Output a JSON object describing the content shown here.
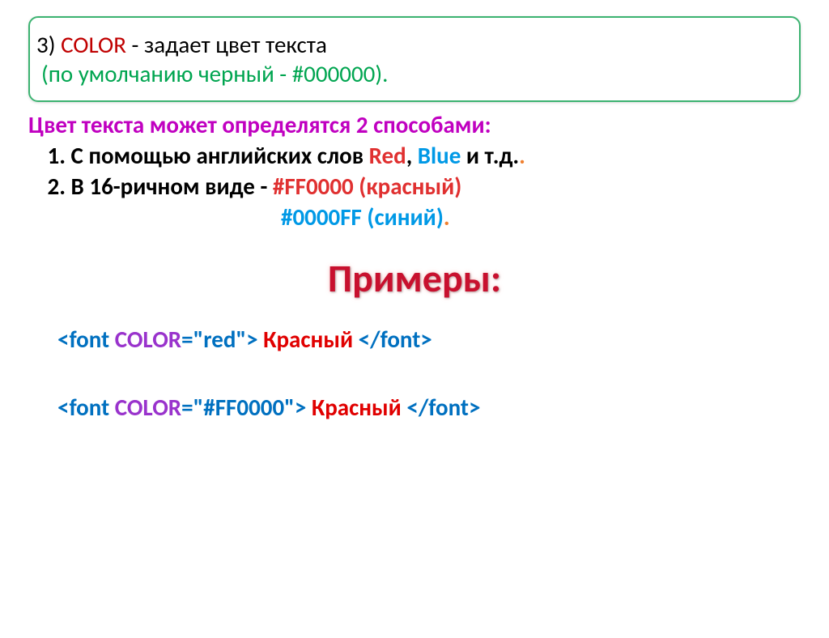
{
  "box": {
    "prefix": "3) ",
    "keyword": "COLOR",
    "suffix": " - задает цвет текста",
    "line2": "(по умолчанию черный - #000000)."
  },
  "intro": "Цвет текста может определятся 2 способами:",
  "item1": {
    "num": "1.",
    "t1": "   С помощью английских слов ",
    "red": "Red",
    "mid": ", ",
    "blue": "Blue",
    "end": " и т.д.",
    "dot": "."
  },
  "item2": {
    "num": "2.",
    "t1": "   В 16-ричном виде - ",
    "hex": "#FF0000",
    "paren": " (красный)"
  },
  "item3": {
    "hex": "#0000FF",
    "paren": " (синий)",
    "dot": "."
  },
  "examples_title": "Примеры:",
  "ex1": {
    "open1": "<font ",
    "attr": "COLOR",
    "open2": "=\"red\"> ",
    "content": "Красный",
    "close": " </font>"
  },
  "ex2": {
    "open1": "<font ",
    "attr": "COLOR",
    "open2": "=\"#FF0000\"> ",
    "content": "Красный",
    "close": " </font>"
  }
}
